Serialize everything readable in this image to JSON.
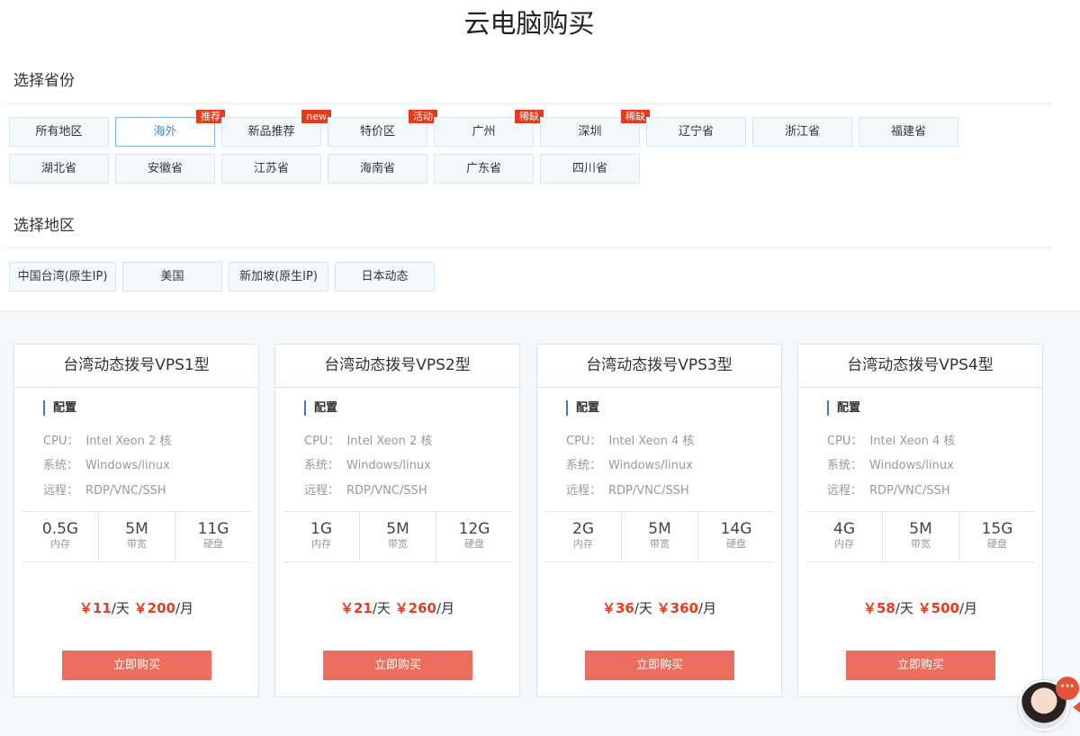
{
  "page": {
    "title": "云电脑购买"
  },
  "province_section": {
    "title": "选择省份",
    "items": [
      {
        "label": "所有地区"
      },
      {
        "label": "海外",
        "badge": "推荐",
        "active": true
      },
      {
        "label": "新品推荐",
        "badge": "new"
      },
      {
        "label": "特价区",
        "badge": "活动"
      },
      {
        "label": "广州",
        "badge": "稀缺"
      },
      {
        "label": "深圳",
        "badge": "稀缺"
      },
      {
        "label": "辽宁省"
      },
      {
        "label": "浙江省"
      },
      {
        "label": "福建省"
      },
      {
        "label": "湖北省"
      },
      {
        "label": "安徽省"
      },
      {
        "label": "江苏省"
      },
      {
        "label": "海南省"
      },
      {
        "label": "广东省"
      },
      {
        "label": "四川省"
      }
    ]
  },
  "region_section": {
    "title": "选择地区",
    "items": [
      {
        "label": "中国台湾(原生IP)"
      },
      {
        "label": "美国"
      },
      {
        "label": "新加坡(原生IP)"
      },
      {
        "label": "日本动态"
      }
    ]
  },
  "products": [
    {
      "title": "台湾动态拨号VPS1型",
      "config_label": "配置",
      "cpu_key": "CPU：",
      "cpu": "Intel Xeon 2 核",
      "os_key": "系统：",
      "os": "Windows/linux",
      "remote_key": "远程：",
      "remote": "RDP/VNC/SSH",
      "memory": "0.5G",
      "memory_label": "内存",
      "bandwidth": "5M",
      "bandwidth_label": "带宽",
      "disk": "11G",
      "disk_label": "硬盘",
      "price_day": "￥11",
      "per_day": "/天",
      "price_month": "￥200",
      "per_month": "/月",
      "buy_label": "立即购买"
    },
    {
      "title": "台湾动态拨号VPS2型",
      "config_label": "配置",
      "cpu_key": "CPU：",
      "cpu": "Intel Xeon 2 核",
      "os_key": "系统：",
      "os": "Windows/linux",
      "remote_key": "远程：",
      "remote": "RDP/VNC/SSH",
      "memory": "1G",
      "memory_label": "内存",
      "bandwidth": "5M",
      "bandwidth_label": "带宽",
      "disk": "12G",
      "disk_label": "硬盘",
      "price_day": "￥21",
      "per_day": "/天",
      "price_month": "￥260",
      "per_month": "/月",
      "buy_label": "立即购买"
    },
    {
      "title": "台湾动态拨号VPS3型",
      "config_label": "配置",
      "cpu_key": "CPU：",
      "cpu": "Intel Xeon 4 核",
      "os_key": "系统：",
      "os": "Windows/linux",
      "remote_key": "远程：",
      "remote": "RDP/VNC/SSH",
      "memory": "2G",
      "memory_label": "内存",
      "bandwidth": "5M",
      "bandwidth_label": "带宽",
      "disk": "14G",
      "disk_label": "硬盘",
      "price_day": "￥36",
      "per_day": "/天",
      "price_month": "￥360",
      "per_month": "/月",
      "buy_label": "立即购买"
    },
    {
      "title": "台湾动态拨号VPS4型",
      "config_label": "配置",
      "cpu_key": "CPU：",
      "cpu": "Intel Xeon 4 核",
      "os_key": "系统：",
      "os": "Windows/linux",
      "remote_key": "远程：",
      "remote": "RDP/VNC/SSH",
      "memory": "4G",
      "memory_label": "内存",
      "bandwidth": "5M",
      "bandwidth_label": "带宽",
      "disk": "15G",
      "disk_label": "硬盘",
      "price_day": "￥58",
      "per_day": "/天",
      "price_month": "￥500",
      "per_month": "/月",
      "buy_label": "立即购买"
    }
  ],
  "support_widget": {
    "bubble_icon": "chat-dots-icon",
    "bubble_text": "···",
    "colors": {
      "accent": "#e5533d"
    }
  },
  "colors": {
    "price": "#e83a1f",
    "buy_button": "#eb6e5f",
    "badge": "#e53a1b",
    "active_chip": "#3d8ed0"
  }
}
